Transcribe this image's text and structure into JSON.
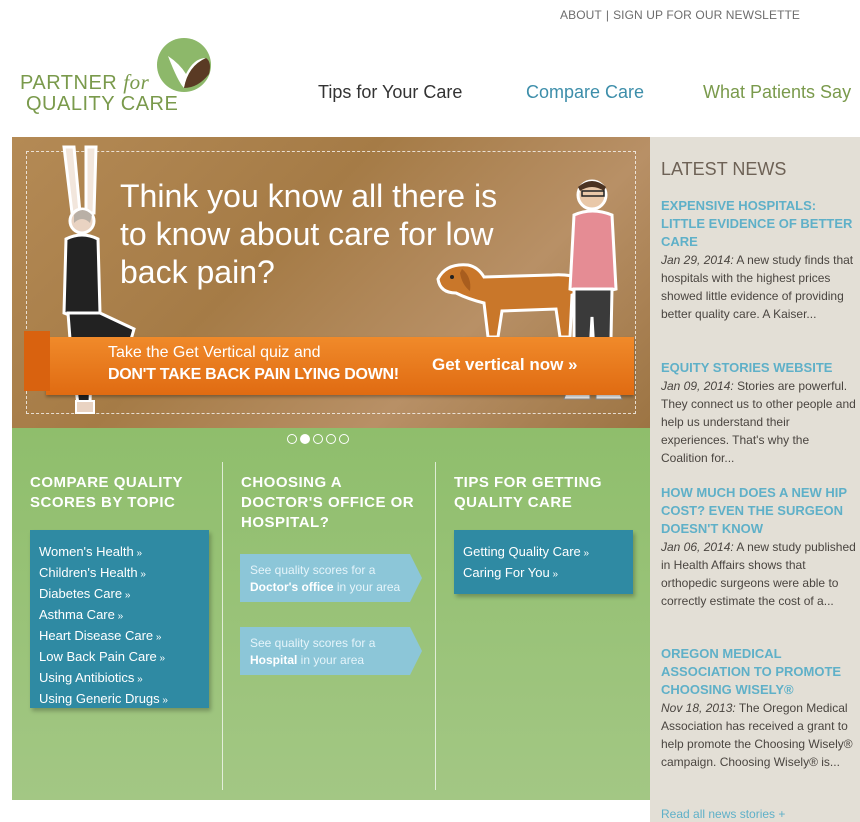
{
  "utility": {
    "about": "ABOUT",
    "separator": "|",
    "signup": "SIGN UP FOR OUR NEWSLETTE"
  },
  "logo": {
    "line1_a": "PARTNER",
    "line1_b": "for",
    "line2": "QUALITY CARE"
  },
  "nav": {
    "tips": "Tips for Your Care",
    "compare": "Compare Care",
    "patients": "What Patients Say"
  },
  "hero": {
    "headline": "Think you know all there is to know about care for low back pain?",
    "banner_line1": "Take the Get Vertical quiz and",
    "banner_line2": "DON'T TAKE BACK PAIN LYING DOWN!",
    "cta": "Get vertical now »"
  },
  "carousel": {
    "total": 5,
    "active": 2
  },
  "columns": {
    "compare": {
      "title": "COMPARE QUALITY SCORES BY TOPIC",
      "links": [
        "Women's Health",
        "Children's Health",
        "Diabetes Care",
        "Asthma Care",
        "Heart Disease Care",
        "Low Back Pain Care",
        "Using Antibiotics",
        "Using Generic Drugs"
      ]
    },
    "choosing": {
      "title": "CHOOSING A DOCTOR'S OFFICE OR HOSPITAL?",
      "doctor": {
        "line1": "See quality scores for a",
        "bold": "Doctor's office",
        "rest": " in your area"
      },
      "hospital": {
        "line1": "See quality scores for a",
        "bold": "Hospital",
        "rest": " in your area"
      }
    },
    "tips": {
      "title": "TIPS FOR GETTING QUALITY CARE",
      "links": [
        "Getting Quality Care",
        "Caring For You"
      ]
    }
  },
  "sidebar": {
    "title": "LATEST NEWS",
    "items": [
      {
        "headline": "EXPENSIVE HOSPITALS: LITTLE EVIDENCE OF BETTER CARE",
        "date": "Jan 29, 2014:",
        "body": " A new study finds that hospitals with the highest prices showed little evidence of providing better quality care. A Kaiser..."
      },
      {
        "headline": "EQUITY STORIES WEBSITE",
        "date": "Jan 09, 2014:",
        "body": " Stories are powerful. They connect us to other people and help us understand their experiences. That's why the Coalition for..."
      },
      {
        "headline": "HOW MUCH DOES A NEW HIP COST? EVEN THE SURGEON DOESN'T KNOW",
        "date": "Jan 06, 2014:",
        "body": " A new study published in Health Affairs shows that orthopedic surgeons were able to correctly estimate the cost of a..."
      },
      {
        "headline": "OREGON MEDICAL ASSOCIATION TO PROMOTE CHOOSING WISELY®",
        "date": "Nov 18, 2013:",
        "body": " The Oregon Medical Association has received a grant to help promote the Choosing Wisely® campaign. Choosing Wisely® is..."
      }
    ],
    "read_all": "Read all news stories +"
  },
  "colors": {
    "green": "#8fbe6c",
    "teal": "#2f8aa3",
    "light_teal": "#8cc6d8",
    "orange": "#e8771b",
    "sidebar": "#e3dfd6"
  }
}
